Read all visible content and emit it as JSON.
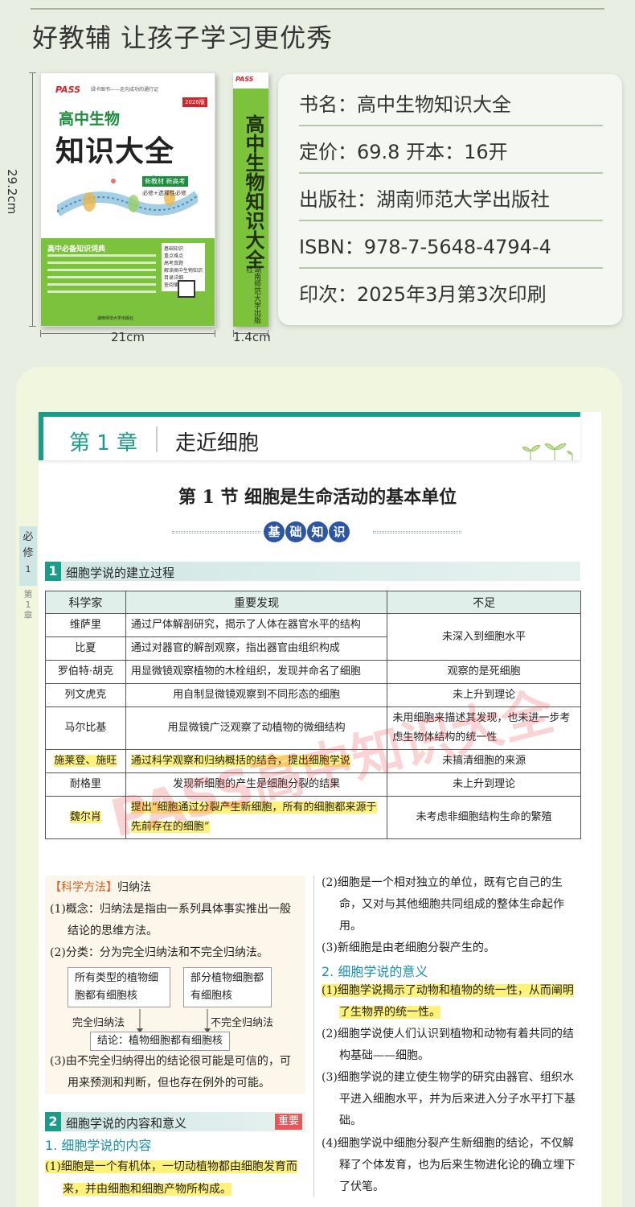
{
  "slogan": "好教辅 让孩子学习更优秀",
  "book": {
    "cover": {
      "logo": "PASS",
      "tagline": "绿卡图书——走向成功的通行证",
      "edition": "2026版",
      "subject": "高中生物",
      "title": "知识大全",
      "badge": "新教材 新高考",
      "badge2": "必修+选择性必修",
      "green_title": "高中必备知识词典",
      "list": [
        "基础知识",
        "重点难点",
        "高考真题",
        "解读高中生物知识",
        "目录详细",
        "查阅便捷"
      ],
      "publisher": "湖南师范大学出版社"
    },
    "spine": {
      "logo": "PASS",
      "title": "高中生物知识大全",
      "publisher": "湖南师范大学出版社"
    },
    "height_label": "29.2cm",
    "width_label": "21cm",
    "spine_label": "1.4cm"
  },
  "info": {
    "name": "书名：高中生物知识大全",
    "price": "定价：69.8  开本：16开",
    "publisher": "出版社：湖南师范大学出版社",
    "isbn": "ISBN：978-7-5648-4794-4",
    "print": "印次：2025年3月第3次印刷"
  },
  "chapter": {
    "num": "第 1 章",
    "name": "走近细胞"
  },
  "section_title": "第 1 节    细胞是生命活动的基本单位",
  "basic_chars": [
    "基",
    "础",
    "知",
    "识"
  ],
  "side_tab": {
    "line1": "必",
    "line2": "修",
    "line3": "1",
    "chap": [
      "第",
      "1",
      "章"
    ]
  },
  "heading1": {
    "num": "1",
    "text": "细胞学说的建立过程"
  },
  "table": {
    "headers": [
      "科学家",
      "重要发现",
      "不足"
    ],
    "rows": [
      {
        "scientist": "维萨里",
        "finding": "通过尸体解剖研究，揭示了人体在器官水平的结构"
      },
      {
        "scientist": "比夏",
        "finding": "通过对器官的解剖观察，指出器官由组织构成"
      },
      {
        "scientist": "罗伯特·胡克",
        "finding": "用显微镜观察植物的木栓组织，发现并命名了细胞",
        "flaw": "观察的是死细胞"
      },
      {
        "scientist": "列文虎克",
        "finding": "用自制显微镜观察到不同形态的细胞",
        "flaw": "未上升到理论"
      },
      {
        "scientist": "马尔比基",
        "finding": "用显微镜广泛观察了动植物的微细结构",
        "flaw": "未用细胞来描述其发现，也未进一步考虑生物体结构的统一性"
      },
      {
        "scientist": "施莱登、施旺",
        "finding": "通过科学观察和归纳概括的结合，提出细胞学说",
        "flaw": "未搞清细胞的来源"
      },
      {
        "scientist": "耐格里",
        "finding": "发现新细胞的产生是细胞分裂的结果",
        "flaw": "未上升到理论"
      },
      {
        "scientist": "魏尔肖",
        "finding": "提出“细胞通过分裂产生新细胞，所有的细胞都来源于先前存在的细胞”",
        "flaw": "未考虑非细胞结构生命的繁殖"
      }
    ],
    "merged_flaw": "未深入到细胞水平"
  },
  "watermark": "PASS高中知识大全",
  "method": {
    "tag": "【科学方法】",
    "tag_name": "归纳法",
    "p1": "(1)概念：归纳法是指由一系列具体事实推出一般结论的思维方法。",
    "p2": "(2)分类：分为完全归纳法和不完全归纳法。",
    "box_left": "所有类型的植物细胞都有细胞核",
    "box_right": "部分植物细胞都有细胞核",
    "label_left": "完全归纳法",
    "label_right": "不完全归纳法",
    "conclusion": "结论：植物细胞都有细胞核",
    "p3": "(3)由不完全归纳得出的结论很可能是可信的，可用来预测和判断，但也存在例外的可能。"
  },
  "heading2": {
    "num": "2",
    "text": "细胞学说的内容和意义",
    "badge": "重要"
  },
  "sub1": "1. 细胞学说的内容",
  "content_p1": "(1)细胞是一个有机体，一切动植物都由细胞发育而来，并由细胞和细胞产物所构成。",
  "right": {
    "p2": "(2)细胞是一个相对独立的单位，既有它自己的生命，又对与其他细胞共同组成的整体生命起作用。",
    "p3": "(3)新细胞是由老细胞分裂产生的。",
    "sub2": "2. 细胞学说的意义",
    "m1": "(1)细胞学说揭示了动物和植物的统一性，从而阐明了生物界的统一性。",
    "m2": "(2)细胞学说使人们认识到植物和动物有着共同的结构基础——细胞。",
    "m3": "(3)细胞学说的建立使生物学的研究由器官、组织水平进入细胞水平，并为后来进入分子水平打下基础。",
    "m4": "(4)细胞学说中细胞分裂产生新细胞的结论，不仅解释了个体发育，也为后来生物进化论的确立埋下了伏笔。"
  }
}
